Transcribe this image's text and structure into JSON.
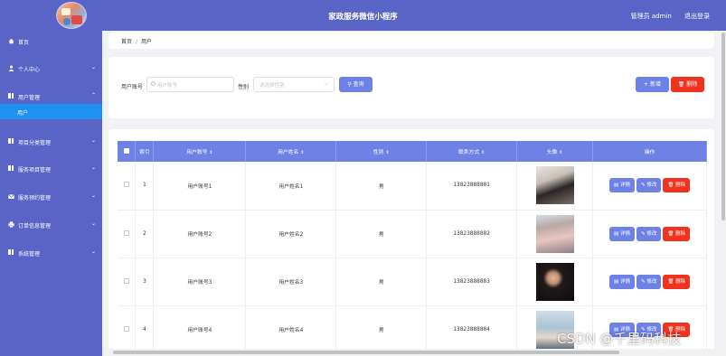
{
  "header": {
    "title": "家政服务微信小程序",
    "admin_label": "管理员 admin",
    "logout_label": "退出登录"
  },
  "sidebar": {
    "items": [
      {
        "label": "首页",
        "icon": "home-icon"
      },
      {
        "label": "个人中心",
        "icon": "user-icon"
      },
      {
        "label": "用户管理",
        "icon": "grid-icon"
      },
      {
        "label": "项目分类管理",
        "icon": "grid-icon"
      },
      {
        "label": "服务项目管理",
        "icon": "grid-icon"
      },
      {
        "label": "服务预约管理",
        "icon": "mail-icon"
      },
      {
        "label": "订单信息管理",
        "icon": "printer-icon"
      },
      {
        "label": "系统管理",
        "icon": "grid-icon"
      }
    ],
    "active_sub_item": "用户"
  },
  "breadcrumb": {
    "home": "首页",
    "separator": "/",
    "current": "用户"
  },
  "filter": {
    "account_label": "用户账号",
    "account_placeholder": "用户账号",
    "gender_label": "性别",
    "gender_placeholder": "请选择性别",
    "search_button": "查询",
    "add_button": "+ 新增",
    "delete_button": "删除"
  },
  "table": {
    "columns": [
      "索引",
      "用户账号",
      "用户姓名",
      "性别",
      "联系方式",
      "头像",
      "操作"
    ],
    "rows": [
      {
        "index": "1",
        "account": "用户账号1",
        "name": "用户姓名1",
        "gender": "男",
        "phone": "13823888881"
      },
      {
        "index": "2",
        "account": "用户账号2",
        "name": "用户姓名2",
        "gender": "男",
        "phone": "13823888882"
      },
      {
        "index": "3",
        "account": "用户账号3",
        "name": "用户姓名3",
        "gender": "男",
        "phone": "13823888883"
      },
      {
        "index": "4",
        "account": "用户账号4",
        "name": "用户姓名4",
        "gender": "男",
        "phone": "13823888884"
      }
    ],
    "actions": {
      "detail": "详情",
      "edit": "修改",
      "delete": "删除"
    }
  },
  "watermark": "CSDN @千里码科技",
  "colors": {
    "primary": "#5864c6",
    "button_blue": "#6e82e6",
    "danger": "#f0321e",
    "active_nav": "#1e90f0"
  }
}
